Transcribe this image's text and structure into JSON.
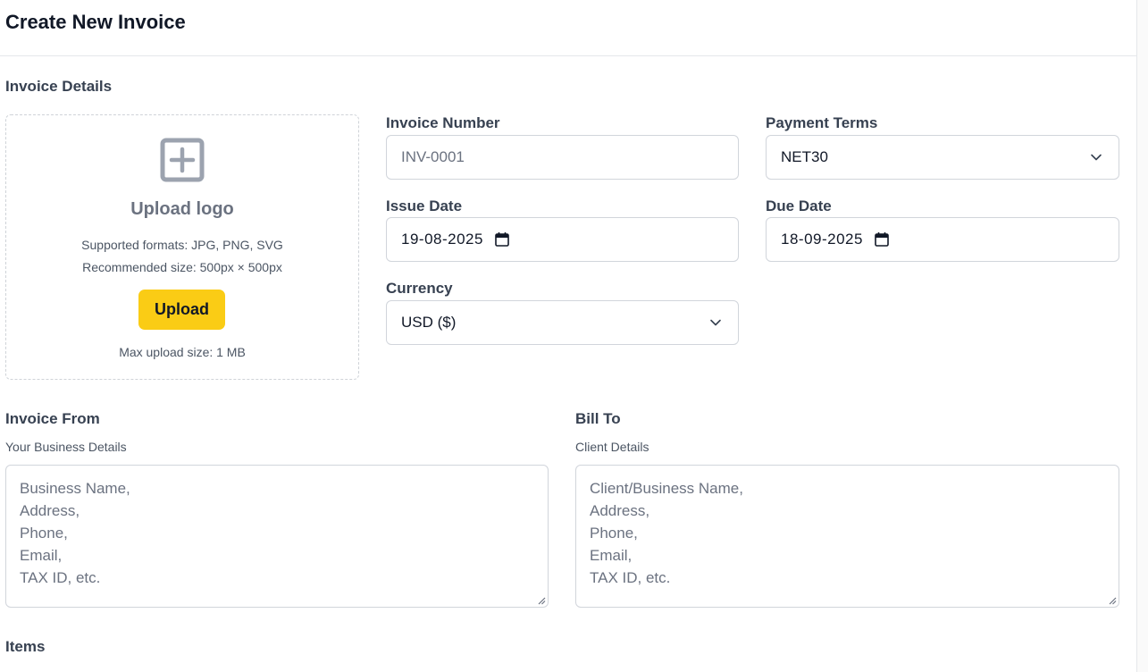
{
  "header": {
    "title": "Create New Invoice"
  },
  "invoice_details": {
    "section_title": "Invoice Details",
    "upload": {
      "title": "Upload logo",
      "formats": "Supported formats: JPG, PNG, SVG",
      "recommended": "Recommended size: 500px × 500px",
      "button_label": "Upload",
      "max_size": "Max upload size: 1 MB",
      "icon": "plus-square-icon"
    },
    "invoice_number": {
      "label": "Invoice Number",
      "placeholder": "INV-0001"
    },
    "payment_terms": {
      "label": "Payment Terms",
      "value": "NET30"
    },
    "issue_date": {
      "label": "Issue Date",
      "value": "19-08-2025"
    },
    "due_date": {
      "label": "Due Date",
      "value": "18-09-2025"
    },
    "currency": {
      "label": "Currency",
      "value": "USD ($)"
    }
  },
  "invoice_from": {
    "title": "Invoice From",
    "subtitle": "Your Business Details",
    "placeholder": "Business Name,\nAddress,\nPhone,\nEmail,\nTAX ID, etc."
  },
  "bill_to": {
    "title": "Bill To",
    "subtitle": "Client Details",
    "placeholder": "Client/Business Name,\nAddress,\nPhone,\nEmail,\nTAX ID, etc."
  },
  "items": {
    "title": "Items"
  },
  "colors": {
    "accent": "#facc15",
    "border": "#d1d5db",
    "muted_text": "#6b7280",
    "label_text": "#374151"
  }
}
